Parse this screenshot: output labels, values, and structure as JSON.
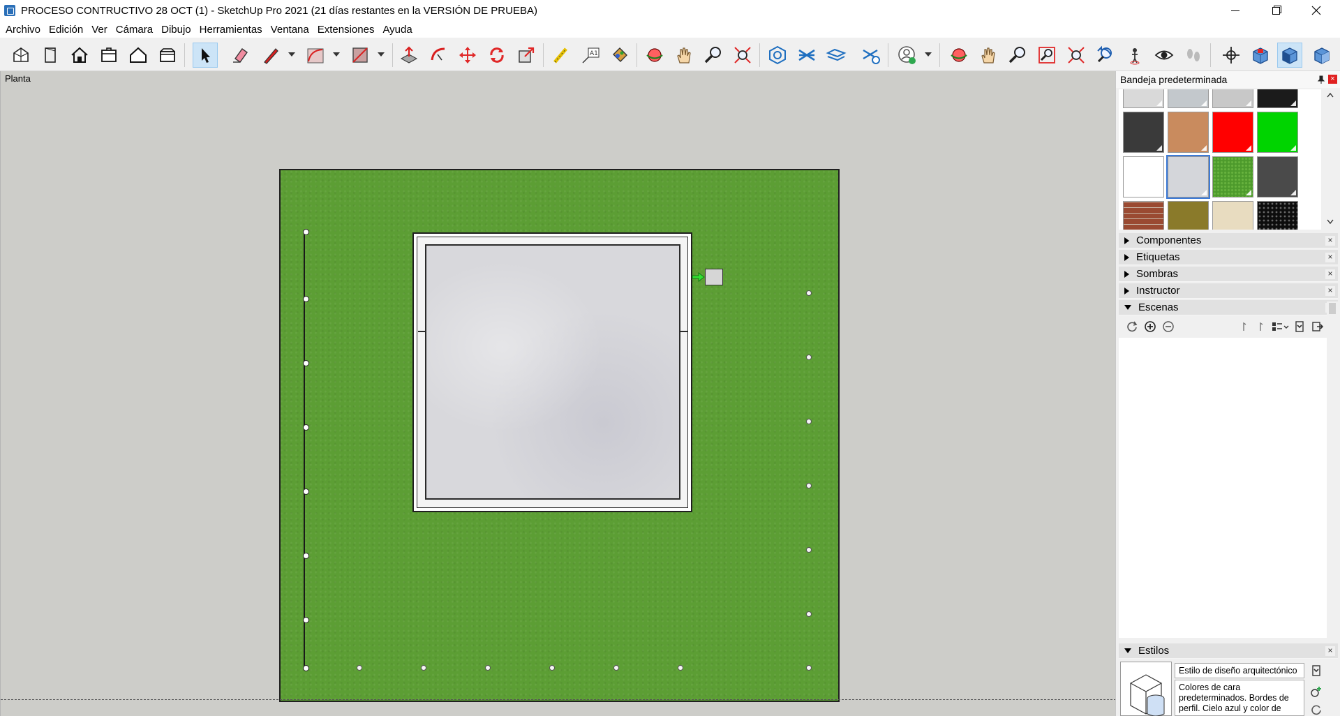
{
  "window": {
    "title": "PROCESO CONTRUCTIVO 28 OCT (1) - SketchUp Pro 2021 (21 días restantes en la VERSIÓN DE PRUEBA)"
  },
  "menu": {
    "items": [
      "Archivo",
      "Edición",
      "Ver",
      "Cámara",
      "Dibujo",
      "Herramientas",
      "Ventana",
      "Extensiones",
      "Ayuda"
    ]
  },
  "toolbar": {
    "icons": [
      "iso-view-icon",
      "front-view-icon",
      "home-view-icon",
      "top-view-icon",
      "house-outline-icon",
      "back-view-icon",
      "select-arrow-icon",
      "eraser-icon",
      "pencil-line-icon",
      "arc-icon",
      "rectangle-shape-icon",
      "push-pull-icon",
      "follow-me-icon",
      "move-icon",
      "rotate-icon",
      "scale-icon",
      "tape-measure-icon",
      "text-label-icon",
      "paint-bucket-icon",
      "orbit-icon",
      "pan-hand-icon",
      "zoom-icon",
      "zoom-extents-icon",
      "warehouse-icon",
      "extension-warehouse-icon",
      "layout-icon",
      "extension-manager-icon",
      "account-icon",
      "orbit2-icon",
      "pan2-icon",
      "zoom2-icon",
      "zoom-window-icon",
      "zoom-extents2-icon",
      "previous-view-icon",
      "position-camera-icon",
      "look-around-icon",
      "walk-icon",
      "axes-icon",
      "top-view-box-icon",
      "iso-box-icon",
      "right-view-box-icon"
    ],
    "active": "select-arrow-icon"
  },
  "viewport": {
    "scene_label": "Planta"
  },
  "panel": {
    "tray_title": "Bandeja predeterminada",
    "material_swatches": [
      {
        "name": "light-gray",
        "color": "#d9d9d9"
      },
      {
        "name": "blue-gray",
        "color": "#c3c8cc"
      },
      {
        "name": "silver",
        "color": "#c8c8c8"
      },
      {
        "name": "black",
        "color": "#1b1b1b"
      },
      {
        "name": "charcoal",
        "color": "#3a3a3a"
      },
      {
        "name": "wood-terracotta",
        "color": "#c98b5e"
      },
      {
        "name": "red",
        "color": "#ff0000"
      },
      {
        "name": "green",
        "color": "#00d400"
      },
      {
        "name": "white",
        "color": "#ffffff"
      },
      {
        "name": "concrete",
        "color": "#d4d6da",
        "selected": true
      },
      {
        "name": "grass",
        "color": "#4d9a2c"
      },
      {
        "name": "asphalt",
        "color": "#4a4a4a"
      },
      {
        "name": "brick",
        "color": "#9a4a32"
      },
      {
        "name": "olive",
        "color": "#8a7a2a"
      },
      {
        "name": "sand",
        "color": "#e8dcc0"
      },
      {
        "name": "dots-black",
        "color": "#0d0d0d"
      }
    ],
    "sections": [
      {
        "label": "Componentes",
        "open": false
      },
      {
        "label": "Etiquetas",
        "open": false
      },
      {
        "label": "Sombras",
        "open": false
      },
      {
        "label": "Instructor",
        "open": false
      },
      {
        "label": "Escenas",
        "open": true
      }
    ],
    "styles_section": {
      "label": "Estilos",
      "open": true
    },
    "style": {
      "name": "Estilo de diseño arquitectónico",
      "description": "Colores de cara predeterminados. Bordes de perfil. Cielo azul y color de"
    }
  },
  "colors": {
    "grass": "#5c9e34",
    "sky_background": "#cdcdc9",
    "accent": "#3d7bd8"
  }
}
